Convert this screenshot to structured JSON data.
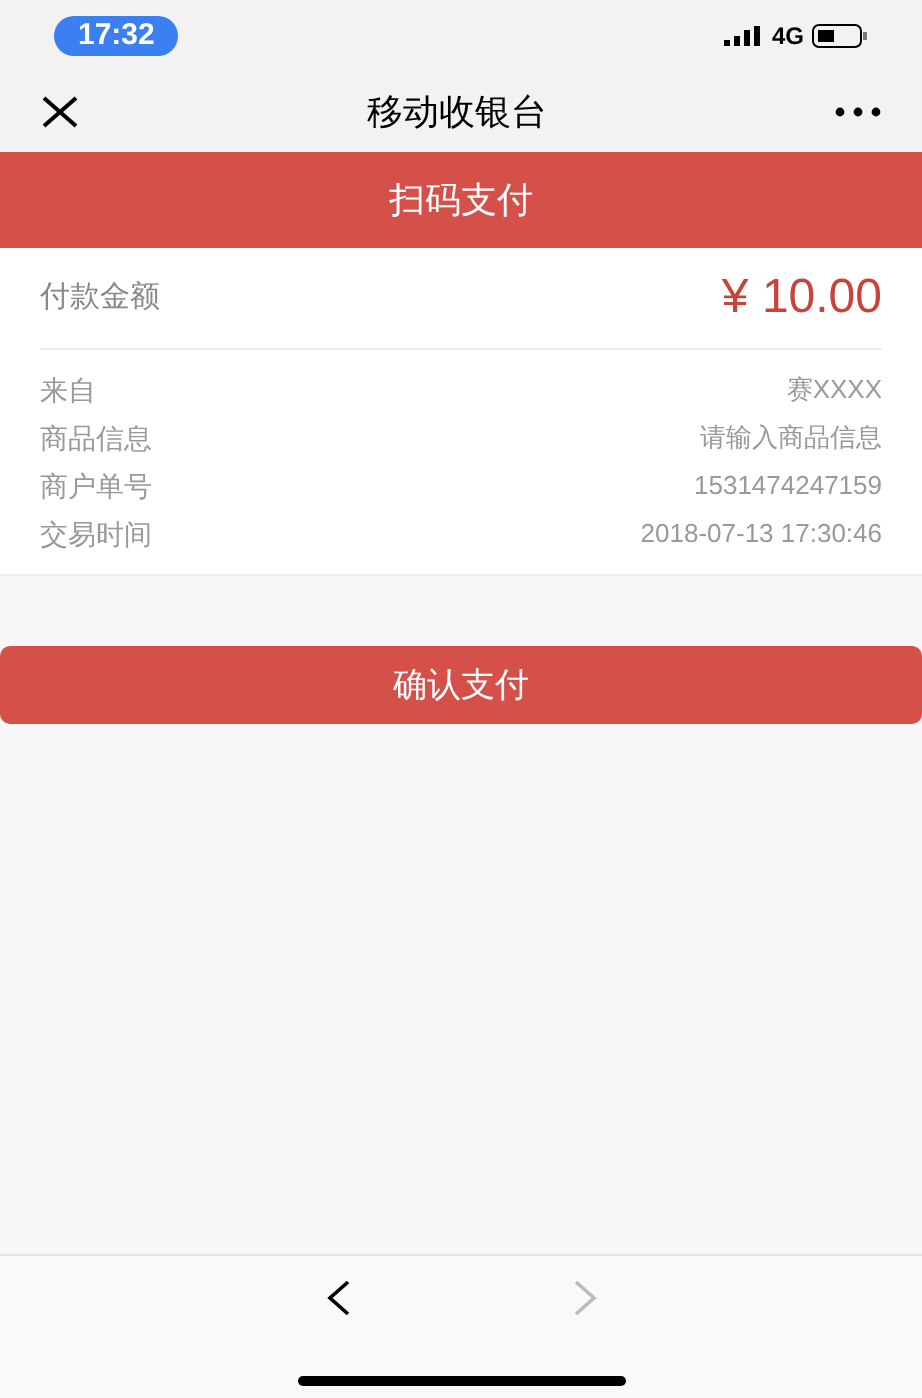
{
  "status_bar": {
    "time": "17:32",
    "network": "4G"
  },
  "nav_bar": {
    "title": "移动收银台"
  },
  "header": {
    "title": "扫码支付"
  },
  "amount": {
    "label": "付款金额",
    "value": "¥ 10.00"
  },
  "details": [
    {
      "label": "来自",
      "value": "赛XXXX"
    },
    {
      "label": "商品信息",
      "value": "请输入商品信息"
    },
    {
      "label": "商户单号",
      "value": "1531474247159"
    },
    {
      "label": "交易时间",
      "value": "2018-07-13 17:30:46"
    }
  ],
  "confirm_button": {
    "label": "确认支付"
  },
  "toolbar": {
    "back": {
      "disabled": false
    },
    "forward": {
      "disabled": true
    }
  }
}
